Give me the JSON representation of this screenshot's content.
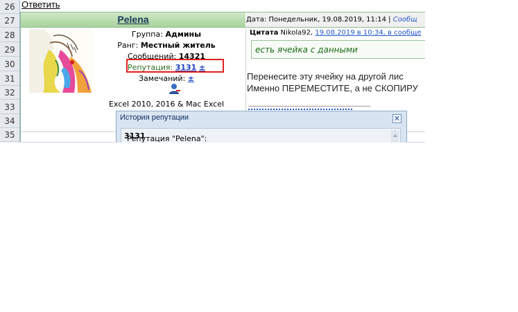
{
  "reply_link": "Ответить",
  "row_numbers": [
    "26",
    "27",
    "28",
    "29",
    "30",
    "31",
    "32",
    "33",
    "34",
    "35"
  ],
  "post": {
    "username": "Pelena",
    "date_label": "Дата: Понедельник, 19.08.2019, 11:14 | ",
    "date_link": "Сообщ",
    "group_label": "Группа: ",
    "group_value": "Админы",
    "rank_label": "Ранг: ",
    "rank_value": "Местный житель",
    "posts_label": "Сообщений: ",
    "posts_value": "14321",
    "rep_label": "Репутация: ",
    "rep_value": "3131",
    "rep_plusminus": "±",
    "warn_label": "Замечаний: ",
    "warn_plusminus": "±",
    "user_icon": "user-profile-icon",
    "versions": "Excel 2010, 2016 & Mac Excel",
    "quote_label": "Цитата",
    "quote_author": " Nikola92, ",
    "quote_link": "19.08.2019 в 10:34, в сообще",
    "quote_text": "есть ячейка с данными",
    "body_line1": "Перенесите эту ячейку на другой лис",
    "body_line2": "Именно ПЕРЕМЕСТИТЕ, а не СКОПИРУ"
  },
  "popup": {
    "title": "История репутации",
    "close_icon": "close-icon",
    "content_label": "Репутация \"Pelena\":",
    "content_value": "3131"
  },
  "colors": {
    "highlight_box": "#e02020",
    "link": "#1f3fbf",
    "header_green": "#a9d39c"
  }
}
